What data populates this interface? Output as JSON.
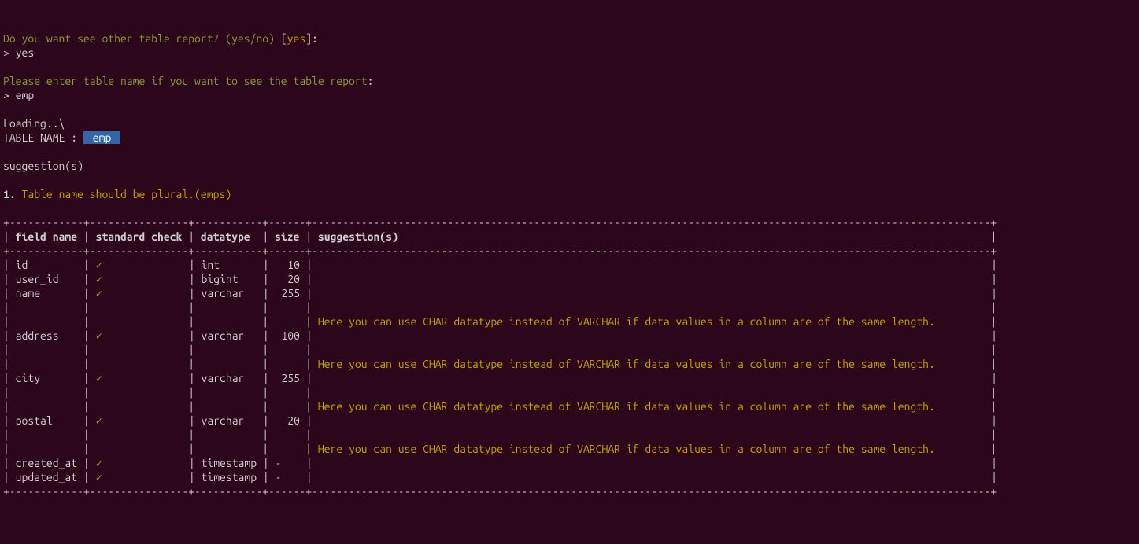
{
  "prompt1": {
    "question": "Do you want see other table report? (yes/no) ",
    "bracket_open": "[",
    "default": "yes",
    "bracket_close": "]:",
    "caret": "> ",
    "answer": "yes"
  },
  "prompt2": {
    "question": "Please enter table name if you want to see the table report",
    "colon": ":",
    "caret": "> ",
    "answer": "emp"
  },
  "loading": "Loading..\\",
  "table_label": "TABLE NAME : ",
  "table_name": " emp ",
  "suggestions_header": "suggestion(s)",
  "numbered_suggestion": {
    "num": "1. ",
    "text": "Table name should be plural.(emps)"
  },
  "headers": {
    "field_name": "field name",
    "standard_check": "standard check",
    "datatype": "datatype",
    "size": "size",
    "suggestions": "suggestion(s)"
  },
  "check_mark": "✓",
  "sugg_text": "Here you can use CHAR datatype instead of VARCHAR if data values in a column are of the same length.",
  "rows": [
    {
      "field": "id",
      "check": true,
      "datatype": "int",
      "size": "10",
      "sugg": ""
    },
    {
      "field": "user_id",
      "check": true,
      "datatype": "bigint",
      "size": "20",
      "sugg": ""
    },
    {
      "field": "name",
      "check": true,
      "datatype": "varchar",
      "size": "255",
      "sugg": ""
    },
    {
      "field": "address",
      "check": true,
      "datatype": "varchar",
      "size": "100",
      "sugg": ""
    },
    {
      "field": "city",
      "check": true,
      "datatype": "varchar",
      "size": "255",
      "sugg": ""
    },
    {
      "field": "postal",
      "check": true,
      "datatype": "varchar",
      "size": "20",
      "sugg": ""
    },
    {
      "field": "created_at",
      "check": true,
      "datatype": "timestamp",
      "size": "-",
      "sugg": ""
    },
    {
      "field": "updated_at",
      "check": true,
      "datatype": "timestamp",
      "size": "-",
      "sugg": ""
    }
  ],
  "divider": "+------------+----------------+-----------+------+--------------------------------------------------------------------------------------------------------------+",
  "col_widths": {
    "field": 10,
    "check": 14,
    "datatype": 9,
    "size": 4,
    "sugg": 108
  }
}
